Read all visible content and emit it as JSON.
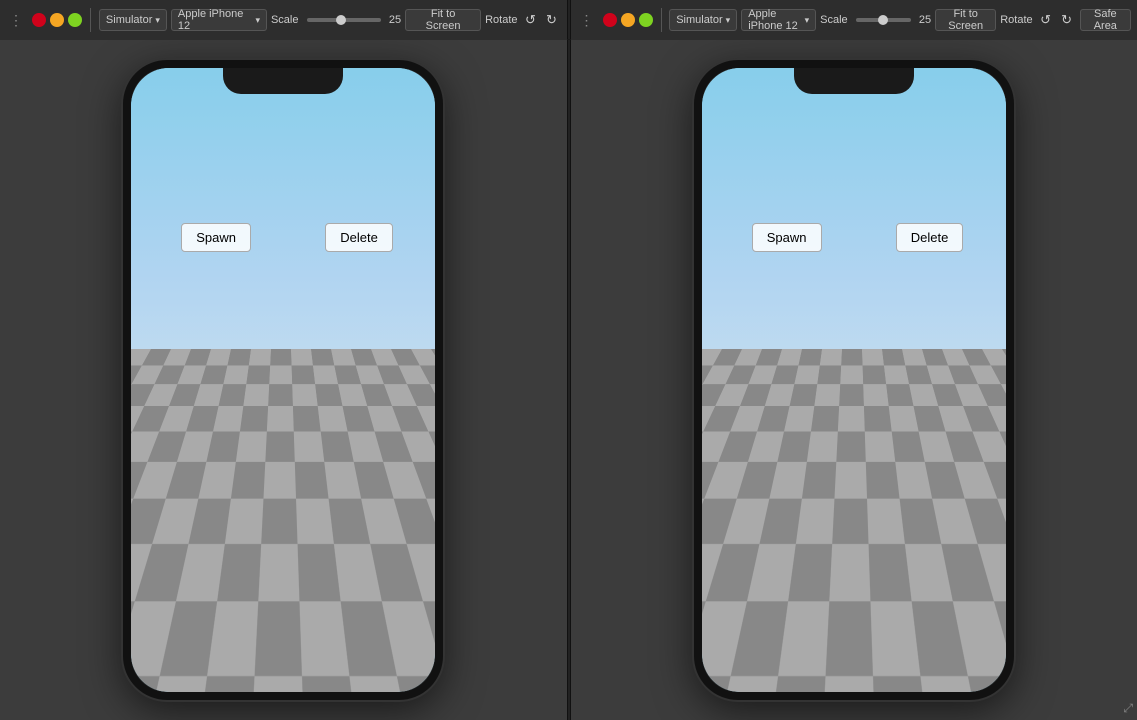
{
  "window": {
    "title_left": "Simulator",
    "title_right": "Simulator"
  },
  "toolbar_left": {
    "simulator_label": "Simulator",
    "device_label": "Apple iPhone 12",
    "scale_label": "Scale",
    "scale_value": "25",
    "fit_to_screen": "Fit to Screen",
    "rotate_label": "Rotate"
  },
  "toolbar_right": {
    "simulator_label": "Simulator",
    "device_label": "Apple iPhone 12",
    "scale_label": "Scale",
    "scale_value": "25",
    "fit_to_screen": "Fit to Screen",
    "rotate_label": "Rotate",
    "safe_area_label": "Safe Area"
  },
  "sim1": {
    "spawn_btn": "Spawn",
    "delete_btn": "Delete"
  },
  "sim2": {
    "spawn_btn": "Spawn",
    "delete_btn": "Delete"
  }
}
